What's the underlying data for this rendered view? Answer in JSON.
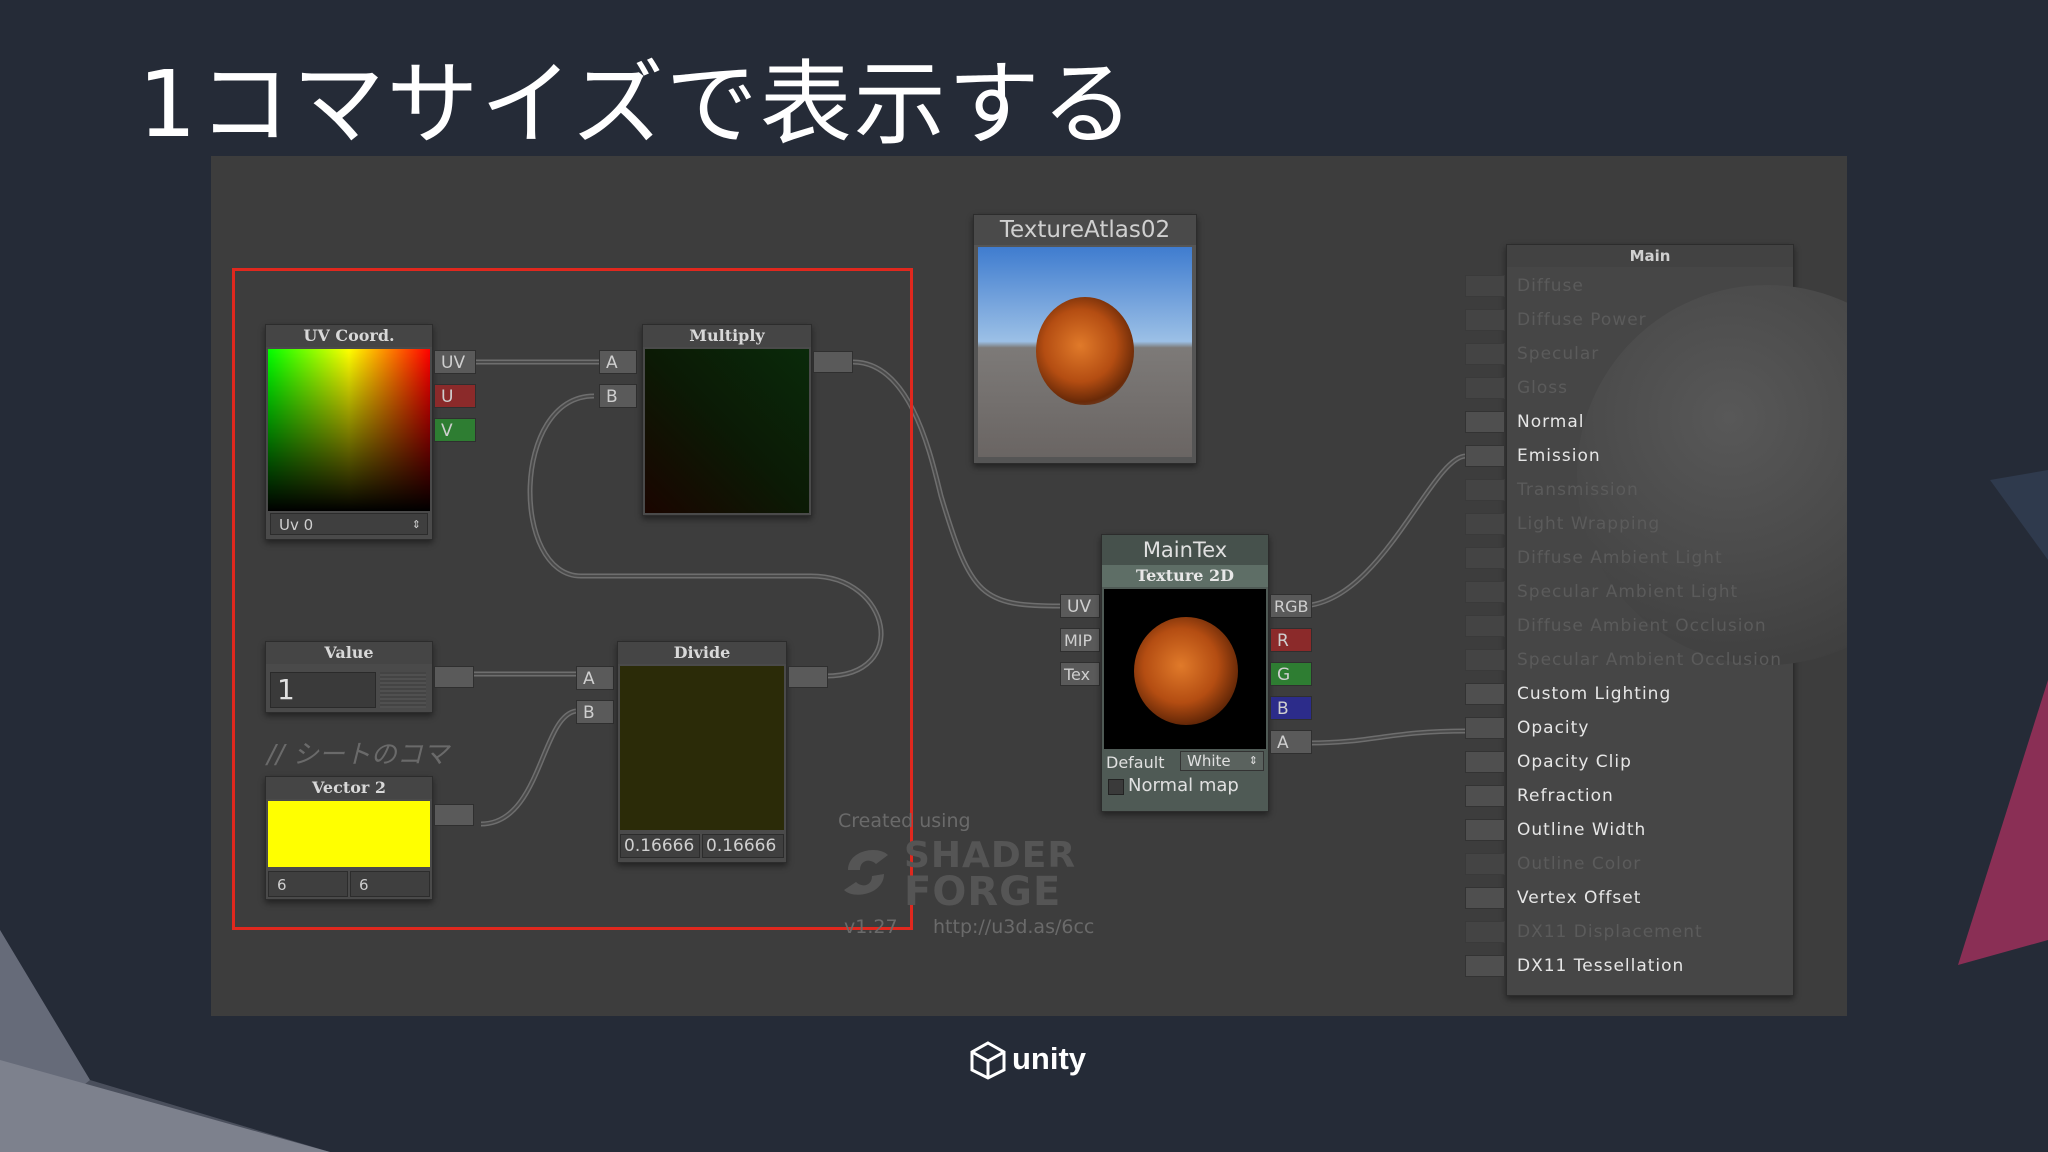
{
  "slide": {
    "title": "1コマサイズで表示する",
    "logo_text": "unity"
  },
  "colors": {
    "background": "#252b37",
    "canvas": "#3d3d3d",
    "highlight_box": "#e0281e",
    "uv_port": "#5a5a5a",
    "u_port": "#8b2a2a",
    "v_port": "#2e7d32",
    "r_port": "#8b2a2a",
    "g_port": "#2e7d32",
    "b_port": "#2c2c8a",
    "vector2_preview": "#ffff00"
  },
  "nodes": {
    "uv_coord": {
      "title": "UV Coord.",
      "ports": [
        "UV",
        "U",
        "V"
      ],
      "dropdown_value": "Uv 0"
    },
    "multiply": {
      "title": "Multiply",
      "inputs": [
        "A",
        "B"
      ]
    },
    "value": {
      "title": "Value",
      "value": "1"
    },
    "comment": "// シートのコマ",
    "vector2": {
      "title": "Vector 2",
      "x": "6",
      "y": "6"
    },
    "divide": {
      "title": "Divide",
      "inputs": [
        "A",
        "B"
      ],
      "output_x": "0.16666",
      "output_y": "0.16666"
    },
    "texture_atlas": {
      "title": "TextureAtlas02"
    },
    "maintex": {
      "title": "MainTex",
      "subtitle": "Texture 2D",
      "inputs": [
        "UV",
        "MIP",
        "Tex"
      ],
      "outputs": [
        "RGB",
        "R",
        "G",
        "B",
        "A"
      ],
      "default_label": "Default",
      "default_value": "White",
      "normal_map_label": "Normal map"
    },
    "main": {
      "title": "Main",
      "inputs": [
        {
          "label": "Diffuse",
          "active": false
        },
        {
          "label": "Diffuse Power",
          "active": false
        },
        {
          "label": "Specular",
          "active": false
        },
        {
          "label": "Gloss",
          "active": false
        },
        {
          "label": "Normal",
          "active": true
        },
        {
          "label": "Emission",
          "active": true
        },
        {
          "label": "Transmission",
          "active": false
        },
        {
          "label": "Light Wrapping",
          "active": false
        },
        {
          "label": "Diffuse Ambient Light",
          "active": false
        },
        {
          "label": "Specular Ambient Light",
          "active": false
        },
        {
          "label": "Diffuse Ambient Occlusion",
          "active": false
        },
        {
          "label": "Specular Ambient Occlusion",
          "active": false
        },
        {
          "label": "Custom Lighting",
          "active": true
        },
        {
          "label": "Opacity",
          "active": true
        },
        {
          "label": "Opacity Clip",
          "active": true
        },
        {
          "label": "Refraction",
          "active": true
        },
        {
          "label": "Outline Width",
          "active": true
        },
        {
          "label": "Outline Color",
          "active": false
        },
        {
          "label": "Vertex Offset",
          "active": true
        },
        {
          "label": "DX11 Displacement",
          "active": false
        },
        {
          "label": "DX11 Tessellation",
          "active": true
        }
      ]
    }
  },
  "watermark": {
    "created_using": "Created using",
    "brand_line1": "SHADER",
    "brand_line2": "FORGE",
    "version": "v1.27",
    "url": "http://u3d.as/6cc"
  }
}
